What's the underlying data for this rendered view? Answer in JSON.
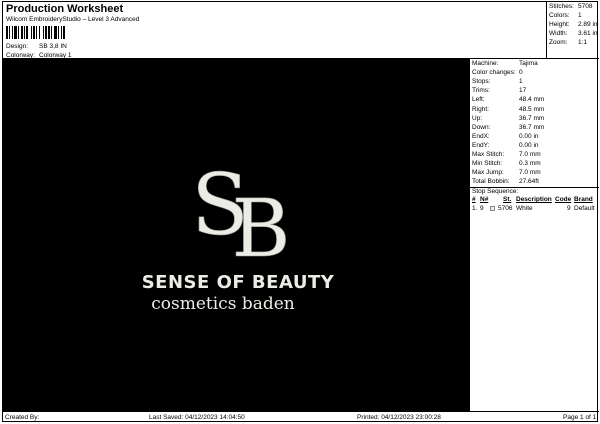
{
  "header": {
    "title": "Production Worksheet",
    "subtitle": "Wilcom EmbroideryStudio – Level 3 Advanced",
    "design_label": "Design:",
    "design_value": "SB 3,8 IN",
    "colorway_label": "Colorway:",
    "colorway_value": "Colorway 1"
  },
  "stats": [
    {
      "label": "Stitches:",
      "value": "5708"
    },
    {
      "label": "Colors:",
      "value": "1"
    },
    {
      "label": "Height:",
      "value": "2.89 in"
    },
    {
      "label": "Width:",
      "value": "3.61 in"
    },
    {
      "label": "Zoom:",
      "value": "1:1"
    }
  ],
  "info": [
    {
      "label": "Machine:",
      "value": "Tajima"
    },
    {
      "label": "Color changes:",
      "value": "0"
    },
    {
      "label": "Stops:",
      "value": "1"
    },
    {
      "label": "Trims:",
      "value": "17"
    },
    {
      "label": "Left:",
      "value": "48.4 mm"
    },
    {
      "label": "Right:",
      "value": "48.5 mm"
    },
    {
      "label": "Up:",
      "value": "36.7 mm"
    },
    {
      "label": "Down:",
      "value": "36.7 mm"
    },
    {
      "label": "EndX:",
      "value": "0.00 in"
    },
    {
      "label": "EndY:",
      "value": "0.00 in"
    },
    {
      "label": "Max Stitch:",
      "value": "7.0 mm"
    },
    {
      "label": "Min Stitch:",
      "value": "0.3 mm"
    },
    {
      "label": "Max Jump:",
      "value": "7.0 mm"
    },
    {
      "label": "Total Bobbin:",
      "value": "27.64ft"
    }
  ],
  "stop_sequence": {
    "title": "Stop Sequence:",
    "columns": [
      "#",
      "N#",
      "St.",
      "Description",
      "Code",
      "Brand"
    ],
    "rows": [
      {
        "num": "1.",
        "n": "9",
        "st": "5706",
        "description": "White",
        "code": "9",
        "brand": "Default"
      }
    ]
  },
  "design_art": {
    "monogram": "SB",
    "line1": "SENSE OF BEAUTY",
    "line2": "cosmetics baden",
    "thread_color": "#ecece6",
    "background_color": "#000000"
  },
  "footer": {
    "created_by": "Created By:",
    "last_saved": "Last Saved: 04/12/2023 14:04:50",
    "printed": "Printed: 04/12/2023 23:00:28",
    "page": "Page 1 of 1"
  }
}
